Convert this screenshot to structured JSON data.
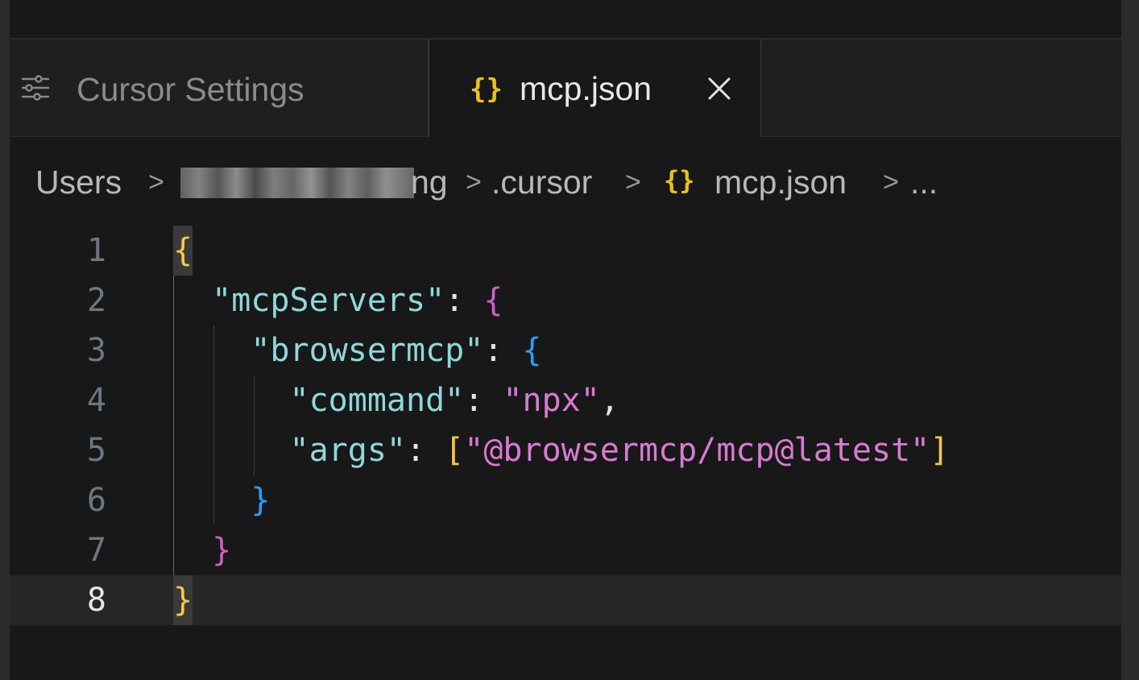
{
  "tabs": [
    {
      "label": "Cursor Settings",
      "icon": "settings-sliders-icon",
      "active": false
    },
    {
      "label": "mcp.json",
      "icon": "json-braces-icon",
      "active": true,
      "close_icon": "close-icon"
    }
  ],
  "breadcrumb": {
    "items": [
      "Users",
      "ng",
      ".cursor",
      "mcp.json",
      "..."
    ],
    "separator": ">",
    "file_icon": "{}"
  },
  "editor": {
    "line_numbers": [
      "1",
      "2",
      "3",
      "4",
      "5",
      "6",
      "7",
      "8"
    ],
    "current_line": 8,
    "lines": [
      [
        {
          "t": "{",
          "c": "b1"
        }
      ],
      [
        {
          "t": "  ",
          "c": "p"
        },
        {
          "t": "\"mcpServers\"",
          "c": "k"
        },
        {
          "t": ": ",
          "c": "p"
        },
        {
          "t": "{",
          "c": "b2"
        }
      ],
      [
        {
          "t": "    ",
          "c": "p"
        },
        {
          "t": "\"browsermcp\"",
          "c": "k"
        },
        {
          "t": ": ",
          "c": "p"
        },
        {
          "t": "{",
          "c": "b3"
        }
      ],
      [
        {
          "t": "      ",
          "c": "p"
        },
        {
          "t": "\"command\"",
          "c": "k"
        },
        {
          "t": ": ",
          "c": "p"
        },
        {
          "t": "\"npx\"",
          "c": "s"
        },
        {
          "t": ",",
          "c": "p"
        }
      ],
      [
        {
          "t": "      ",
          "c": "p"
        },
        {
          "t": "\"args\"",
          "c": "k"
        },
        {
          "t": ": ",
          "c": "p"
        },
        {
          "t": "[",
          "c": "b1"
        },
        {
          "t": "\"@browsermcp/mcp@latest\"",
          "c": "s"
        },
        {
          "t": "]",
          "c": "b1"
        }
      ],
      [
        {
          "t": "    ",
          "c": "p"
        },
        {
          "t": "}",
          "c": "b3"
        }
      ],
      [
        {
          "t": "  ",
          "c": "p"
        },
        {
          "t": "}",
          "c": "b2"
        }
      ],
      [
        {
          "t": "}",
          "c": "b1"
        }
      ]
    ]
  },
  "colors": {
    "key": "#8fd8d8",
    "string": "#d77bd1",
    "bracket_level1": "#f2c94c",
    "bracket_level2": "#cf5fc7",
    "bracket_level3": "#2b9df4",
    "background": "#181818"
  }
}
